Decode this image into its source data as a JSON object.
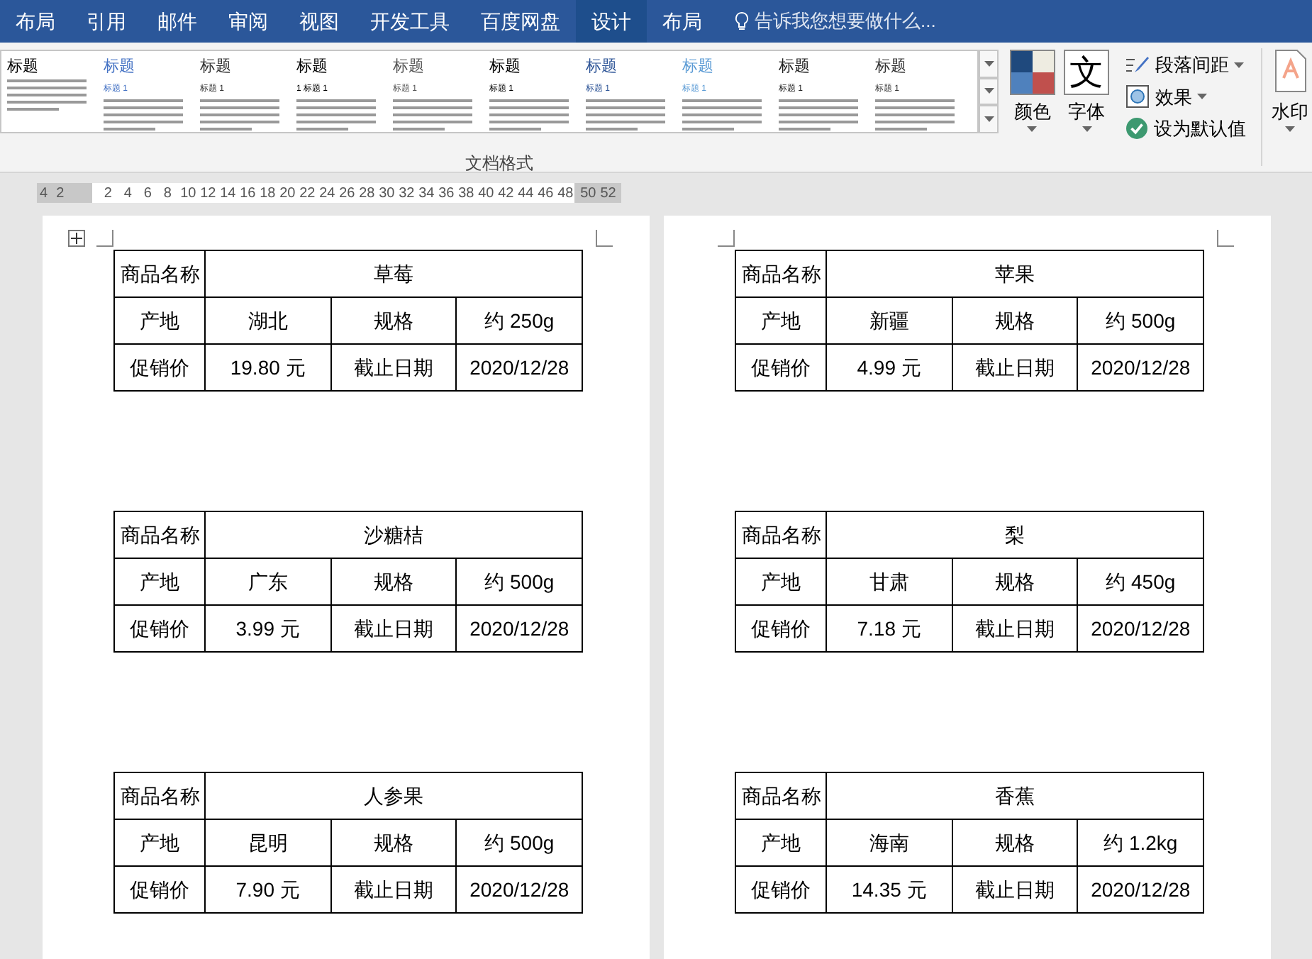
{
  "tabs": [
    {
      "label": "布局",
      "selected": false
    },
    {
      "label": "引用",
      "selected": false
    },
    {
      "label": "邮件",
      "selected": false
    },
    {
      "label": "审阅",
      "selected": false
    },
    {
      "label": "视图",
      "selected": false
    },
    {
      "label": "开发工具",
      "selected": false
    },
    {
      "label": "百度网盘",
      "selected": false
    },
    {
      "label": "设计",
      "selected": true
    },
    {
      "label": "布局",
      "selected": false
    }
  ],
  "tell_me": {
    "placeholder": "告诉我您想要做什么..."
  },
  "style_gallery": {
    "label": "文档格式",
    "styles": [
      {
        "heading": "标题",
        "color": "#000000"
      },
      {
        "heading": "标题",
        "subheading": "标题 1",
        "color": "#4472c4"
      },
      {
        "heading": "标题",
        "subheading": "标题 1",
        "color": "#333333"
      },
      {
        "heading": "标题",
        "subheading": "1 标题 1",
        "color": "#000000"
      },
      {
        "heading": "标题",
        "subheading": "标题 1",
        "color": "#555555"
      },
      {
        "heading": "标题",
        "subheading": "标题 1",
        "color": "#000000"
      },
      {
        "heading": "标题",
        "subheading": "标题 1",
        "color": "#2e5597"
      },
      {
        "heading": "标题",
        "subheading": "标题 1",
        "color": "#5b9bd5"
      },
      {
        "heading": "标题",
        "subheading": "标题 1",
        "color": "#222222"
      },
      {
        "heading": "标题",
        "subheading": "标题 1",
        "color": "#333333"
      }
    ]
  },
  "design_buttons": {
    "colors": "颜色",
    "fonts": "字体",
    "font_glyph": "文",
    "paragraph_spacing": "段落间距",
    "effects": "效果",
    "set_default": "设为默认值",
    "watermark": "水印"
  },
  "ruler": {
    "left_labels": [
      "4",
      "2"
    ],
    "labels": [
      "2",
      "4",
      "6",
      "8",
      "10",
      "12",
      "14",
      "16",
      "18",
      "20",
      "22",
      "24",
      "26",
      "28",
      "30",
      "32",
      "34",
      "36",
      "38",
      "40",
      "42",
      "44",
      "46",
      "48"
    ],
    "right_labels": [
      "50",
      "52"
    ]
  },
  "pages": [
    {
      "tables": [
        {
          "name_label": "商品名称",
          "name": "草莓",
          "origin_label": "产地",
          "origin": "湖北",
          "spec_label": "规格",
          "spec": "约 250g",
          "price_label": "促销价",
          "price": "19.80 元",
          "date_label": "截止日期",
          "date": "2020/12/28"
        },
        {
          "name_label": "商品名称",
          "name": "沙糖桔",
          "origin_label": "产地",
          "origin": "广东",
          "spec_label": "规格",
          "spec": "约 500g",
          "price_label": "促销价",
          "price": "3.99 元",
          "date_label": "截止日期",
          "date": "2020/12/28"
        },
        {
          "name_label": "商品名称",
          "name": "人参果",
          "origin_label": "产地",
          "origin": "昆明",
          "spec_label": "规格",
          "spec": "约 500g",
          "price_label": "促销价",
          "price": "7.90 元",
          "date_label": "截止日期",
          "date": "2020/12/28"
        }
      ]
    },
    {
      "tables": [
        {
          "name_label": "商品名称",
          "name": "苹果",
          "origin_label": "产地",
          "origin": "新疆",
          "spec_label": "规格",
          "spec": "约 500g",
          "price_label": "促销价",
          "price": "4.99 元",
          "date_label": "截止日期",
          "date": "2020/12/28"
        },
        {
          "name_label": "商品名称",
          "name": "梨",
          "origin_label": "产地",
          "origin": "甘肃",
          "spec_label": "规格",
          "spec": "约 450g",
          "price_label": "促销价",
          "price": "7.18 元",
          "date_label": "截止日期",
          "date": "2020/12/28"
        },
        {
          "name_label": "商品名称",
          "name": "香蕉",
          "origin_label": "产地",
          "origin": "海南",
          "spec_label": "规格",
          "spec": "约 1.2kg",
          "price_label": "促销价",
          "price": "14.35 元",
          "date_label": "截止日期",
          "date": "2020/12/28"
        }
      ]
    }
  ]
}
